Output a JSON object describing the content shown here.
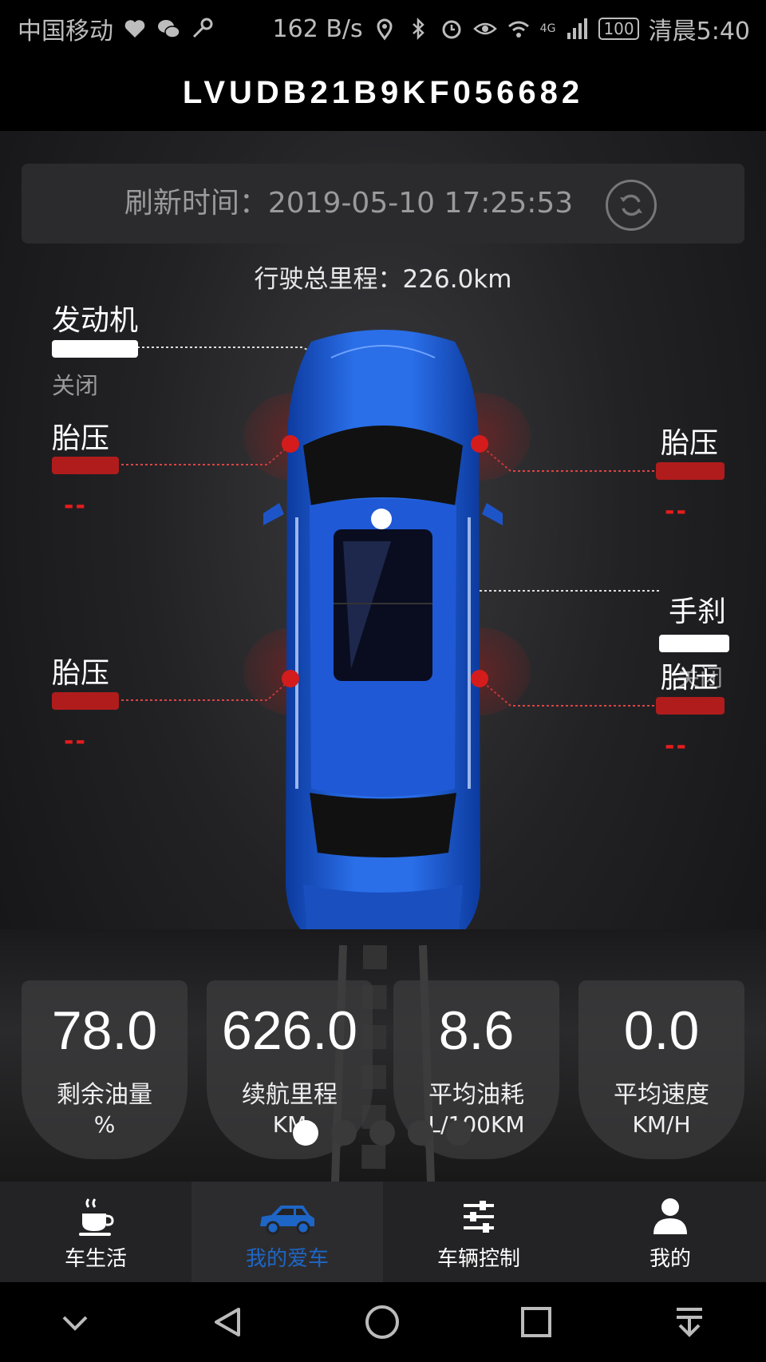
{
  "status": {
    "carrier": "中国移动",
    "speed": "162 B/s",
    "network": "4G",
    "battery": "100",
    "time": "清晨5:40"
  },
  "header": {
    "vin": "LVUDB21B9KF056682"
  },
  "refresh": {
    "label": "刷新时间：2019-05-10 17:25:53",
    "icon": "refresh-icon"
  },
  "mileage": {
    "label": "行驶总里程：226.0km"
  },
  "engine": {
    "title": "发动机",
    "state": "关闭"
  },
  "handbrake": {
    "title": "手刹",
    "state": "关闭"
  },
  "tires": {
    "front_left": {
      "title": "胎压",
      "value": "--"
    },
    "front_right": {
      "title": "胎压",
      "value": "--"
    },
    "rear_left": {
      "title": "胎压",
      "value": "--"
    },
    "rear_right": {
      "title": "胎压",
      "value": "--"
    }
  },
  "stats": [
    {
      "value": "78.0",
      "name": "剩余油量",
      "unit": "%"
    },
    {
      "value": "626.0",
      "name": "续航里程",
      "unit": "KM"
    },
    {
      "value": "8.6",
      "name": "平均油耗",
      "unit": "L/100KM"
    },
    {
      "value": "0.0",
      "name": "平均速度",
      "unit": "KM/H"
    }
  ],
  "pager": {
    "count": 5,
    "active": 0
  },
  "tabs": [
    {
      "label": "车生活",
      "icon": "coffee-cup-icon"
    },
    {
      "label": "我的爱车",
      "icon": "car-icon",
      "active": true
    },
    {
      "label": "车辆控制",
      "icon": "sliders-icon"
    },
    {
      "label": "我的",
      "icon": "person-icon"
    }
  ],
  "colors": {
    "accent": "#1e66c6",
    "alert": "#e51c1c",
    "tire_bar": "#b01c1c"
  }
}
